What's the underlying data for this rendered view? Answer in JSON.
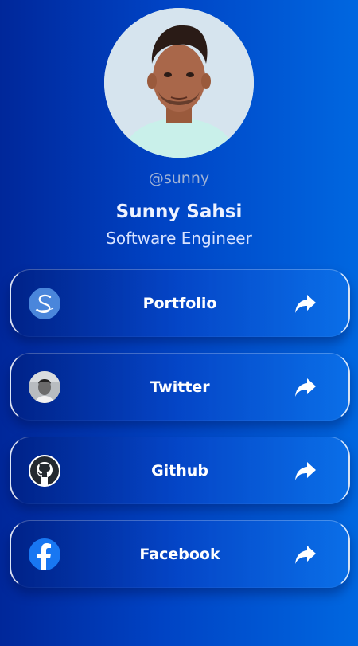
{
  "profile": {
    "handle": "@sunny",
    "name": "Sunny Sahsi",
    "title": "Software Engineer"
  },
  "links": [
    {
      "label": "Portfolio",
      "icon": "portfolio-logo-icon"
    },
    {
      "label": "Twitter",
      "icon": "twitter-avatar-icon"
    },
    {
      "label": "Github",
      "icon": "github-icon"
    },
    {
      "label": "Facebook",
      "icon": "facebook-icon"
    }
  ],
  "colors": {
    "background_start": "#00279a",
    "background_end": "#0067e0",
    "facebook_blue": "#1877f2"
  }
}
